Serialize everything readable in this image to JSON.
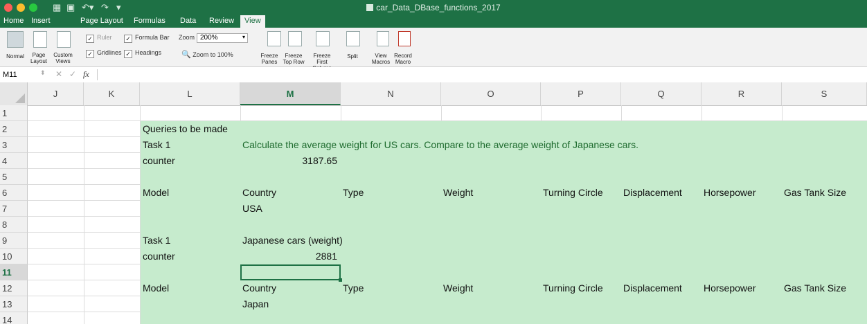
{
  "window": {
    "title": "car_Data_DBase_functions_2017"
  },
  "tabs": [
    "Home",
    "Insert",
    "Page Layout",
    "Formulas",
    "Data",
    "Review",
    "View"
  ],
  "ribbon": {
    "workbook_views": {
      "normal": "Normal",
      "page_layout": "Page Layout",
      "custom_views": "Custom Views"
    },
    "show": {
      "ruler": "Ruler",
      "formula_bar": "Formula Bar",
      "gridlines": "Gridlines",
      "headings": "Headings"
    },
    "zoom": {
      "label": "Zoom",
      "value": "200%",
      "to100": "Zoom to 100%"
    },
    "freeze_panes": "Freeze Panes",
    "freeze_top_row": "Freeze Top Row",
    "freeze_first_column": "Freeze First Column",
    "split": "Split",
    "view_macros": "View Macros",
    "record_macro": "Record Macro"
  },
  "formula_bar": {
    "name_box": "M11",
    "fx": "fx",
    "content": ""
  },
  "columns": [
    "J",
    "K",
    "L",
    "M",
    "N",
    "O",
    "P",
    "Q",
    "R",
    "S"
  ],
  "selected_column": "M",
  "rows": [
    "1",
    "2",
    "3",
    "4",
    "5",
    "6",
    "7",
    "8",
    "9",
    "10",
    "11",
    "12",
    "13",
    "14"
  ],
  "selected_row": "11",
  "cells": {
    "L2": "Queries to be made",
    "L3": "Task 1",
    "M3": "Calculate the average weight for US cars. Compare to the average weight of Japanese cars.",
    "L4": "counter",
    "M4": "3187.65",
    "L6": "Model",
    "M6": "Country",
    "N6": "Type",
    "O6": "Weight",
    "P6": "Turning Circle",
    "Q6": "Displacement",
    "R6": "Horsepower",
    "S6": "Gas Tank Size",
    "M7": "USA",
    "L9": "Task 1",
    "M9": "Japanese cars (weight)",
    "L10": "counter",
    "M10": "2881",
    "L12": "Model",
    "M12": "Country",
    "N12": "Type",
    "O12": "Weight",
    "P12": "Turning Circle",
    "Q12": "Displacement",
    "R12": "Horsepower",
    "S12": "Gas Tank Size",
    "M13": "Japan"
  },
  "colors": {
    "excel_green": "#1e7145",
    "fill_green": "#c6ebcd",
    "task_text_green": "#1e6b2e"
  }
}
